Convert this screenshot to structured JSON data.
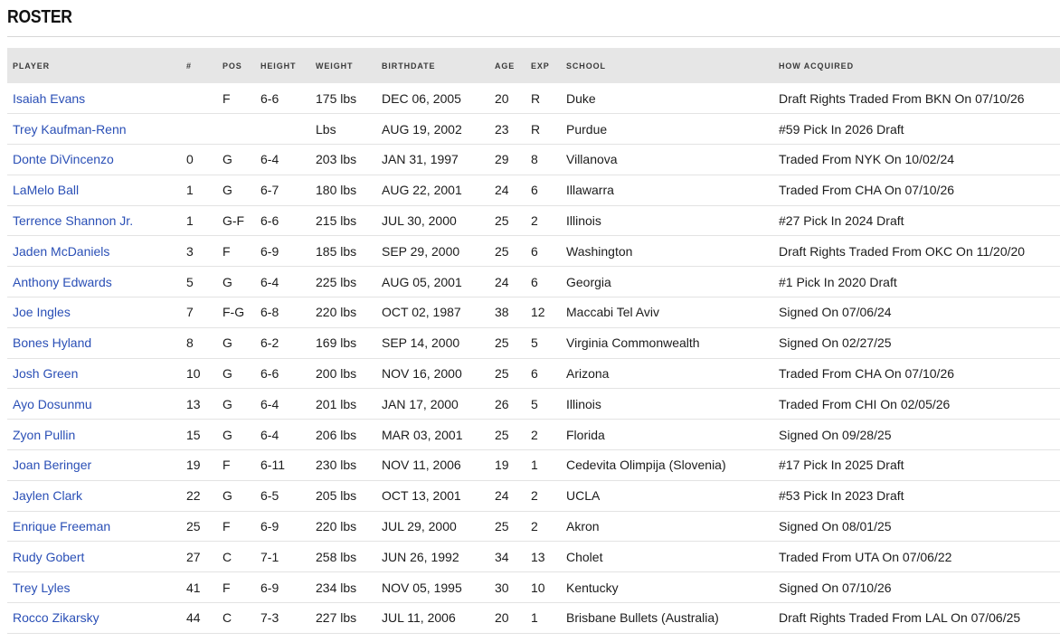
{
  "page": {
    "title": "ROSTER"
  },
  "columns": [
    "PLAYER",
    "#",
    "POS",
    "HEIGHT",
    "WEIGHT",
    "BIRTHDATE",
    "AGE",
    "EXP",
    "SCHOOL",
    "HOW ACQUIRED"
  ],
  "rows": [
    {
      "player": "Isaiah Evans",
      "num": "",
      "pos": "F",
      "height": "6-6",
      "weight": "175 lbs",
      "birthdate": "DEC 06, 2005",
      "age": "20",
      "exp": "R",
      "school": "Duke",
      "acquired": "Draft Rights Traded From BKN On 07/10/26"
    },
    {
      "player": "Trey Kaufman-Renn",
      "num": "",
      "pos": "",
      "height": "",
      "weight": "Lbs",
      "birthdate": "AUG 19, 2002",
      "age": "23",
      "exp": "R",
      "school": "Purdue",
      "acquired": "#59 Pick In 2026 Draft"
    },
    {
      "player": "Donte DiVincenzo",
      "num": "0",
      "pos": "G",
      "height": "6-4",
      "weight": "203 lbs",
      "birthdate": "JAN 31, 1997",
      "age": "29",
      "exp": "8",
      "school": "Villanova",
      "acquired": "Traded From NYK On 10/02/24"
    },
    {
      "player": "LaMelo Ball",
      "num": "1",
      "pos": "G",
      "height": "6-7",
      "weight": "180 lbs",
      "birthdate": "AUG 22, 2001",
      "age": "24",
      "exp": "6",
      "school": "Illawarra",
      "acquired": "Traded From CHA On 07/10/26"
    },
    {
      "player": "Terrence Shannon Jr.",
      "num": "1",
      "pos": "G-F",
      "height": "6-6",
      "weight": "215 lbs",
      "birthdate": "JUL 30, 2000",
      "age": "25",
      "exp": "2",
      "school": "Illinois",
      "acquired": "#27 Pick In 2024 Draft"
    },
    {
      "player": "Jaden McDaniels",
      "num": "3",
      "pos": "F",
      "height": "6-9",
      "weight": "185 lbs",
      "birthdate": "SEP 29, 2000",
      "age": "25",
      "exp": "6",
      "school": "Washington",
      "acquired": "Draft Rights Traded From OKC On 11/20/20"
    },
    {
      "player": "Anthony Edwards",
      "num": "5",
      "pos": "G",
      "height": "6-4",
      "weight": "225 lbs",
      "birthdate": "AUG 05, 2001",
      "age": "24",
      "exp": "6",
      "school": "Georgia",
      "acquired": "#1 Pick In 2020 Draft"
    },
    {
      "player": "Joe Ingles",
      "num": "7",
      "pos": "F-G",
      "height": "6-8",
      "weight": "220 lbs",
      "birthdate": "OCT 02, 1987",
      "age": "38",
      "exp": "12",
      "school": "Maccabi Tel Aviv",
      "acquired": "Signed On 07/06/24"
    },
    {
      "player": "Bones Hyland",
      "num": "8",
      "pos": "G",
      "height": "6-2",
      "weight": "169 lbs",
      "birthdate": "SEP 14, 2000",
      "age": "25",
      "exp": "5",
      "school": "Virginia Commonwealth",
      "acquired": "Signed On 02/27/25"
    },
    {
      "player": "Josh Green",
      "num": "10",
      "pos": "G",
      "height": "6-6",
      "weight": "200 lbs",
      "birthdate": "NOV 16, 2000",
      "age": "25",
      "exp": "6",
      "school": "Arizona",
      "acquired": "Traded From CHA On 07/10/26"
    },
    {
      "player": "Ayo Dosunmu",
      "num": "13",
      "pos": "G",
      "height": "6-4",
      "weight": "201 lbs",
      "birthdate": "JAN 17, 2000",
      "age": "26",
      "exp": "5",
      "school": "Illinois",
      "acquired": "Traded From CHI On 02/05/26"
    },
    {
      "player": "Zyon Pullin",
      "num": "15",
      "pos": "G",
      "height": "6-4",
      "weight": "206 lbs",
      "birthdate": "MAR 03, 2001",
      "age": "25",
      "exp": "2",
      "school": "Florida",
      "acquired": "Signed On 09/28/25"
    },
    {
      "player": "Joan Beringer",
      "num": "19",
      "pos": "F",
      "height": "6-11",
      "weight": "230 lbs",
      "birthdate": "NOV 11, 2006",
      "age": "19",
      "exp": "1",
      "school": "Cedevita Olimpija (Slovenia)",
      "acquired": "#17 Pick In 2025 Draft"
    },
    {
      "player": "Jaylen Clark",
      "num": "22",
      "pos": "G",
      "height": "6-5",
      "weight": "205 lbs",
      "birthdate": "OCT 13, 2001",
      "age": "24",
      "exp": "2",
      "school": "UCLA",
      "acquired": "#53 Pick In 2023 Draft"
    },
    {
      "player": "Enrique Freeman",
      "num": "25",
      "pos": "F",
      "height": "6-9",
      "weight": "220 lbs",
      "birthdate": "JUL 29, 2000",
      "age": "25",
      "exp": "2",
      "school": "Akron",
      "acquired": "Signed On 08/01/25"
    },
    {
      "player": "Rudy Gobert",
      "num": "27",
      "pos": "C",
      "height": "7-1",
      "weight": "258 lbs",
      "birthdate": "JUN 26, 1992",
      "age": "34",
      "exp": "13",
      "school": "Cholet",
      "acquired": "Traded From UTA On 07/06/22"
    },
    {
      "player": "Trey Lyles",
      "num": "41",
      "pos": "F",
      "height": "6-9",
      "weight": "234 lbs",
      "birthdate": "NOV 05, 1995",
      "age": "30",
      "exp": "10",
      "school": "Kentucky",
      "acquired": "Signed On 07/10/26"
    },
    {
      "player": "Rocco Zikarsky",
      "num": "44",
      "pos": "C",
      "height": "7-3",
      "weight": "227 lbs",
      "birthdate": "JUL 11, 2006",
      "age": "20",
      "exp": "1",
      "school": "Brisbane Bullets (Australia)",
      "acquired": "Draft Rights Traded From LAL On 07/06/25"
    }
  ]
}
